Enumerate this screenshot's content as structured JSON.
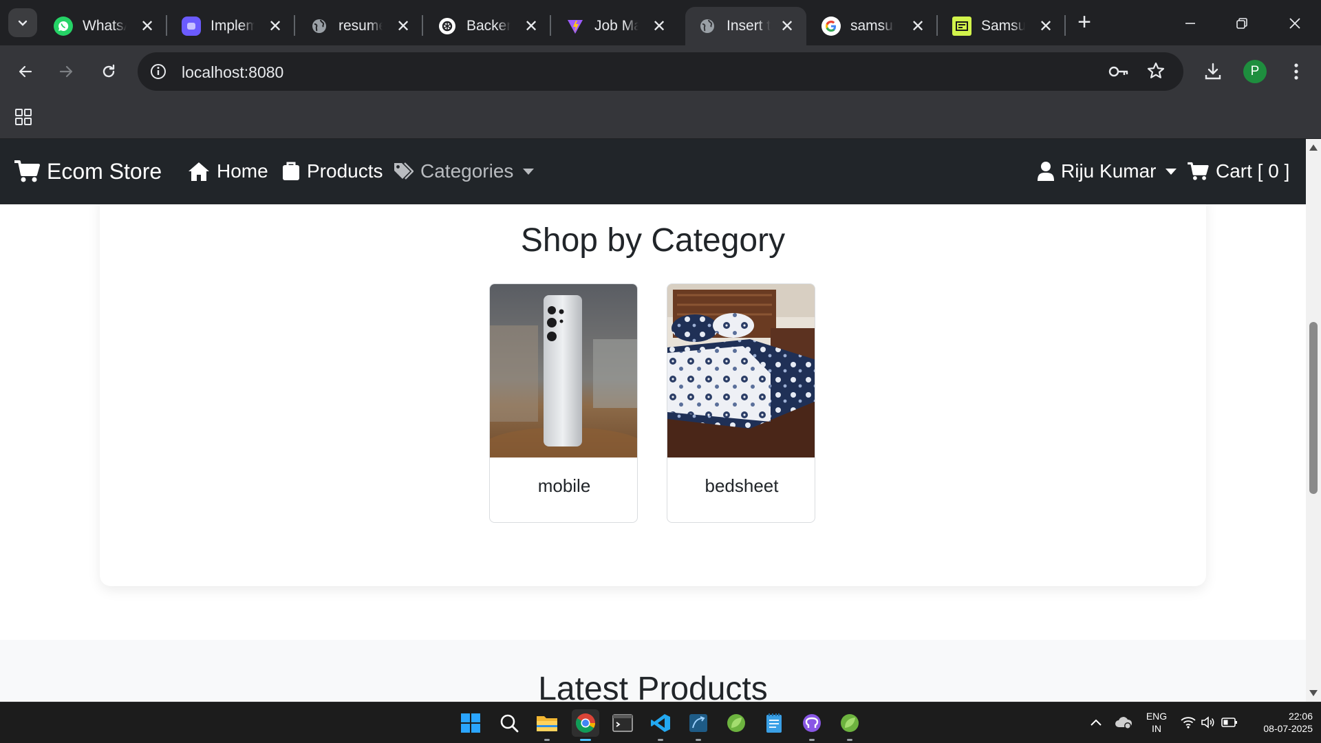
{
  "browser": {
    "tabs": [
      {
        "title": "WhatsApp",
        "icon": "whatsapp-icon",
        "color": "#25d366"
      },
      {
        "title": "Implement",
        "icon": "app-icon",
        "color": "#6b5bff"
      },
      {
        "title": "resume",
        "icon": "globe-icon",
        "color": "#9aa0a6"
      },
      {
        "title": "Backend",
        "icon": "chatgpt-icon",
        "color": "#ffffff"
      },
      {
        "title": "Job Match",
        "icon": "vite-icon",
        "color": "#9d5cff"
      },
      {
        "title": "Insert title",
        "icon": "globe-icon",
        "color": "#9aa0a6",
        "active": true
      },
      {
        "title": "samsung",
        "icon": "google-icon",
        "color": "#4285f4"
      },
      {
        "title": "Samsung",
        "icon": "zdnet-icon",
        "color": "#d2f34b"
      }
    ],
    "url": "localhost:8080",
    "profile_initial": "P"
  },
  "navbar": {
    "brand": "Ecom Store",
    "home": "Home",
    "products": "Products",
    "categories": "Categories",
    "user": "Riju Kumar",
    "cart": "Cart [ 0 ]"
  },
  "categories_section": {
    "heading": "Shop by Category",
    "items": [
      {
        "label": "mobile"
      },
      {
        "label": "bedsheet"
      }
    ]
  },
  "latest_section": {
    "heading": "Latest Products"
  },
  "taskbar": {
    "lang_line1": "ENG",
    "lang_line2": "IN",
    "time": "22:06",
    "date": "08-07-2025"
  },
  "colors": {
    "navbar_bg": "#212529",
    "accent_taskbar": "#4cc2ff",
    "profile_avatar": "#1e8e3e"
  }
}
